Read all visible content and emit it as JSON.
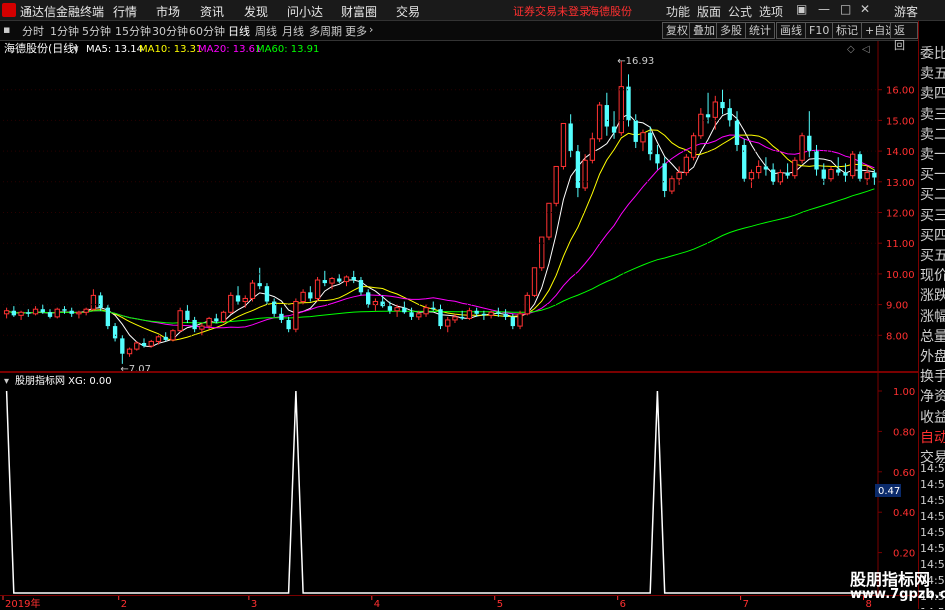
{
  "menubar": {
    "app_title": "通达信金融终端",
    "menus": [
      "行情",
      "市场",
      "资讯",
      "发现",
      "问小达",
      "财富圈",
      "交易"
    ],
    "notice": "证券交易未登录",
    "stock_link": "海德股份",
    "controls": [
      "功能",
      "版面",
      "公式",
      "选项"
    ],
    "guest": "游客"
  },
  "tabbar": {
    "periods": [
      "分时",
      "1分钟",
      "5分钟",
      "15分钟",
      "30分钟",
      "60分钟",
      "日线",
      "周线",
      "月线",
      "多周期",
      "更多"
    ],
    "active": "日线",
    "buttons": [
      "复权",
      "叠加",
      "多股",
      "统计",
      "画线",
      "F10",
      "标记",
      "+自选",
      "返回"
    ]
  },
  "main_chart": {
    "stock_label": "海德股份(日线)",
    "ma": [
      {
        "name": "MA5: 13.14",
        "color": "#ffffff"
      },
      {
        "name": "MA10: 13.31",
        "color": "#ffff00"
      },
      {
        "name": "MA20: 13.61",
        "color": "#ff00ff"
      },
      {
        "name": "MA60: 13.91",
        "color": "#00ff00"
      }
    ],
    "high_label": "16.93",
    "low_label": "7.07",
    "y_ticks": [
      "16.00",
      "15.00",
      "14.00",
      "13.00",
      "12.00",
      "11.00",
      "10.00",
      "9.00",
      "8.00"
    ]
  },
  "sub_chart": {
    "indicator_label": "股朋指标网 XG: 0.00",
    "y_ticks": [
      "1.00",
      "0.80",
      "0.60",
      "0.40",
      "0.20"
    ],
    "current_value": "0.47"
  },
  "x_axis": {
    "labels": [
      "2019年",
      "2",
      "3",
      "4",
      "5",
      "6",
      "7",
      "8"
    ]
  },
  "sidepanel": {
    "header": "委比",
    "items": [
      "委比",
      "卖五",
      "卖四",
      "卖三",
      "卖二",
      "卖一",
      "买一",
      "买二",
      "买三",
      "买四",
      "买五",
      "现价",
      "涨跌",
      "涨幅",
      "总量",
      "外盘",
      "换手",
      "净资",
      "收益",
      "自动",
      "交易"
    ],
    "times": [
      "14:56",
      "14:56",
      "14:56",
      "14:56",
      "14:56",
      "14:56",
      "14:56",
      "14:56",
      "14:56",
      "14:56"
    ]
  },
  "watermark": {
    "title": "股朋指标网",
    "url": "www.7gpzb.com"
  },
  "chart_data": {
    "type": "candlestick",
    "title": "海德股份(日线)",
    "ylim": [
      7.0,
      17.0
    ],
    "candles": [
      [
        8.7,
        8.9,
        8.55,
        8.8
      ],
      [
        8.8,
        8.95,
        8.6,
        8.65
      ],
      [
        8.65,
        8.8,
        8.5,
        8.75
      ],
      [
        8.75,
        8.85,
        8.6,
        8.7
      ],
      [
        8.7,
        8.95,
        8.65,
        8.85
      ],
      [
        8.85,
        9.0,
        8.7,
        8.75
      ],
      [
        8.75,
        8.85,
        8.55,
        8.6
      ],
      [
        8.6,
        8.9,
        8.55,
        8.85
      ],
      [
        8.85,
        8.95,
        8.7,
        8.8
      ],
      [
        8.8,
        8.9,
        8.6,
        8.7
      ],
      [
        8.7,
        8.8,
        8.55,
        8.75
      ],
      [
        8.75,
        8.9,
        8.65,
        8.85
      ],
      [
        8.85,
        9.5,
        8.8,
        9.3
      ],
      [
        9.3,
        9.4,
        8.8,
        8.9
      ],
      [
        8.9,
        9.0,
        8.2,
        8.3
      ],
      [
        8.3,
        8.4,
        7.8,
        7.9
      ],
      [
        7.9,
        8.0,
        7.07,
        7.4
      ],
      [
        7.4,
        7.6,
        7.3,
        7.55
      ],
      [
        7.55,
        7.8,
        7.5,
        7.75
      ],
      [
        7.75,
        7.9,
        7.6,
        7.65
      ],
      [
        7.65,
        7.85,
        7.6,
        7.8
      ],
      [
        7.8,
        8.0,
        7.7,
        7.95
      ],
      [
        7.95,
        8.1,
        7.8,
        7.85
      ],
      [
        7.85,
        8.2,
        7.8,
        8.15
      ],
      [
        8.15,
        8.9,
        8.1,
        8.8
      ],
      [
        8.8,
        9.0,
        8.4,
        8.5
      ],
      [
        8.5,
        8.6,
        8.1,
        8.2
      ],
      [
        8.2,
        8.4,
        8.0,
        8.3
      ],
      [
        8.3,
        8.6,
        8.2,
        8.55
      ],
      [
        8.55,
        8.7,
        8.4,
        8.45
      ],
      [
        8.45,
        8.8,
        8.4,
        8.75
      ],
      [
        8.75,
        9.4,
        8.7,
        9.3
      ],
      [
        9.3,
        9.6,
        9.0,
        9.1
      ],
      [
        9.1,
        9.3,
        8.9,
        9.2
      ],
      [
        9.2,
        9.8,
        9.1,
        9.7
      ],
      [
        9.7,
        10.2,
        9.5,
        9.6
      ],
      [
        9.6,
        9.7,
        9.0,
        9.1
      ],
      [
        9.1,
        9.2,
        8.6,
        8.7
      ],
      [
        8.7,
        8.9,
        8.4,
        8.5
      ],
      [
        8.5,
        8.6,
        8.1,
        8.2
      ],
      [
        8.2,
        9.2,
        8.1,
        9.1
      ],
      [
        9.1,
        9.5,
        9.0,
        9.4
      ],
      [
        9.4,
        9.6,
        9.1,
        9.2
      ],
      [
        9.2,
        9.9,
        9.1,
        9.8
      ],
      [
        9.8,
        10.1,
        9.6,
        9.7
      ],
      [
        9.7,
        9.9,
        9.5,
        9.85
      ],
      [
        9.85,
        10.0,
        9.7,
        9.75
      ],
      [
        9.75,
        9.95,
        9.6,
        9.9
      ],
      [
        9.9,
        10.1,
        9.7,
        9.8
      ],
      [
        9.8,
        9.9,
        9.3,
        9.4
      ],
      [
        9.4,
        9.5,
        8.9,
        9.0
      ],
      [
        9.0,
        9.2,
        8.8,
        9.1
      ],
      [
        9.1,
        9.3,
        8.9,
        8.95
      ],
      [
        8.95,
        9.1,
        8.7,
        8.8
      ],
      [
        8.8,
        9.0,
        8.6,
        8.9
      ],
      [
        8.9,
        9.1,
        8.7,
        8.75
      ],
      [
        8.75,
        8.9,
        8.5,
        8.6
      ],
      [
        8.6,
        8.8,
        8.5,
        8.7
      ],
      [
        8.7,
        9.0,
        8.6,
        8.9
      ],
      [
        8.9,
        9.1,
        8.8,
        8.85
      ],
      [
        8.85,
        9.0,
        8.2,
        8.3
      ],
      [
        8.3,
        8.6,
        8.1,
        8.5
      ],
      [
        8.5,
        8.7,
        8.4,
        8.6
      ],
      [
        8.6,
        8.8,
        8.5,
        8.55
      ],
      [
        8.55,
        8.9,
        8.5,
        8.8
      ],
      [
        8.8,
        8.9,
        8.6,
        8.7
      ],
      [
        8.7,
        8.8,
        8.5,
        8.65
      ],
      [
        8.65,
        8.8,
        8.55,
        8.75
      ],
      [
        8.75,
        8.9,
        8.6,
        8.7
      ],
      [
        8.7,
        8.85,
        8.5,
        8.6
      ],
      [
        8.6,
        8.7,
        8.2,
        8.3
      ],
      [
        8.3,
        8.8,
        8.2,
        8.7
      ],
      [
        8.7,
        9.4,
        8.65,
        9.3
      ],
      [
        9.3,
        10.2,
        9.25,
        10.2
      ],
      [
        10.2,
        11.2,
        10.1,
        11.2
      ],
      [
        11.2,
        12.3,
        11.1,
        12.3
      ],
      [
        12.3,
        13.5,
        12.2,
        13.5
      ],
      [
        13.5,
        14.9,
        13.4,
        14.9
      ],
      [
        14.9,
        15.2,
        13.8,
        14.0
      ],
      [
        14.0,
        14.2,
        12.5,
        12.8
      ],
      [
        12.8,
        13.9,
        12.7,
        13.7
      ],
      [
        13.7,
        14.6,
        13.6,
        14.4
      ],
      [
        14.4,
        15.6,
        14.3,
        15.5
      ],
      [
        15.5,
        15.9,
        14.5,
        14.8
      ],
      [
        14.8,
        15.3,
        14.4,
        14.6
      ],
      [
        14.6,
        16.93,
        14.5,
        16.1
      ],
      [
        16.1,
        16.5,
        14.8,
        15.0
      ],
      [
        15.0,
        15.2,
        14.1,
        14.3
      ],
      [
        14.3,
        14.7,
        14.0,
        14.6
      ],
      [
        14.6,
        14.8,
        13.7,
        13.9
      ],
      [
        13.9,
        14.2,
        13.4,
        13.6
      ],
      [
        13.6,
        13.8,
        12.5,
        12.7
      ],
      [
        12.7,
        13.2,
        12.6,
        13.1
      ],
      [
        13.1,
        13.5,
        12.9,
        13.3
      ],
      [
        13.3,
        13.9,
        13.2,
        13.8
      ],
      [
        13.8,
        14.6,
        13.7,
        14.5
      ],
      [
        14.5,
        15.4,
        14.4,
        15.2
      ],
      [
        15.2,
        15.9,
        14.9,
        15.1
      ],
      [
        15.1,
        15.8,
        14.7,
        15.6
      ],
      [
        15.6,
        16.0,
        15.2,
        15.4
      ],
      [
        15.4,
        15.7,
        14.8,
        15.0
      ],
      [
        15.0,
        15.3,
        14.0,
        14.2
      ],
      [
        14.2,
        14.4,
        13.0,
        13.1
      ],
      [
        13.1,
        13.4,
        12.8,
        13.3
      ],
      [
        13.3,
        13.7,
        13.1,
        13.5
      ],
      [
        13.5,
        13.8,
        13.2,
        13.4
      ],
      [
        13.4,
        13.6,
        12.9,
        13.0
      ],
      [
        13.0,
        13.4,
        12.9,
        13.3
      ],
      [
        13.3,
        13.6,
        13.1,
        13.2
      ],
      [
        13.2,
        13.8,
        13.1,
        13.7
      ],
      [
        13.7,
        14.6,
        13.6,
        14.5
      ],
      [
        14.5,
        15.3,
        13.8,
        14.0
      ],
      [
        14.0,
        14.2,
        13.2,
        13.4
      ],
      [
        13.4,
        13.6,
        12.9,
        13.1
      ],
      [
        13.1,
        13.5,
        13.0,
        13.4
      ],
      [
        13.4,
        13.8,
        13.2,
        13.3
      ],
      [
        13.3,
        13.6,
        13.0,
        13.2
      ],
      [
        13.2,
        14.0,
        13.1,
        13.9
      ],
      [
        13.9,
        14.0,
        13.0,
        13.1
      ],
      [
        13.1,
        13.5,
        12.9,
        13.3
      ],
      [
        13.3,
        13.4,
        12.9,
        13.14
      ]
    ],
    "xg_signal_indices": [
      0,
      40,
      90
    ]
  }
}
